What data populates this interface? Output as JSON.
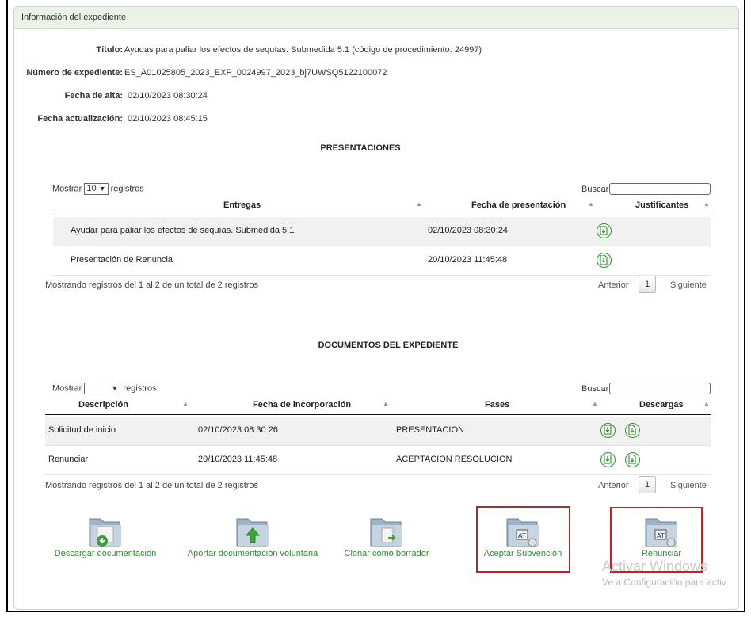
{
  "panel": {
    "title": "Información del expediente"
  },
  "info": {
    "titulo_label": "Título:",
    "titulo_value": "Ayudas para paliar los efectos de sequías. Submedida 5.1 (código de procedimiento: 24997)",
    "numero_label": "Número de expediente:",
    "numero_value": "ES_A01025805_2023_EXP_0024997_2023_bj7UWSQ5122100072",
    "alta_label": "Fecha de alta:",
    "alta_value": "02/10/2023 08:30:24",
    "actualizacion_label": "Fecha actualización:",
    "actualizacion_value": "02/10/2023 08:45:15"
  },
  "presentaciones": {
    "title": "PRESENTACIONES",
    "show_prefix": "Mostrar",
    "show_value": "10",
    "show_suffix": "registros",
    "search_label": "Buscar:",
    "columns": [
      "Entregas",
      "Fecha de presentación",
      "Justificantes"
    ],
    "rows": [
      {
        "entrega": "Ayudar para paliar los efectos de sequías. Submedida 5.1",
        "fecha": "02/10/2023 08:30:24"
      },
      {
        "entrega": "Presentación de Renuncia",
        "fecha": "20/10/2023 11:45:48"
      }
    ],
    "info": "Mostrando registros del 1 al 2 de un total de 2 registros",
    "prev": "Anterior",
    "page": "1",
    "next": "Siguiente"
  },
  "documentos": {
    "title": "DOCUMENTOS DEL EXPEDIENTE",
    "show_prefix": "Mostrar",
    "show_value": "",
    "show_suffix": "registros",
    "search_label": "Buscar:",
    "columns": [
      "Descripción",
      "Fecha de incorporación",
      "Fases",
      "Descargas"
    ],
    "rows": [
      {
        "descripcion": "Solicitud de inicio",
        "fecha": "02/10/2023 08:30:26",
        "fase": "PRESENTACION"
      },
      {
        "descripcion": "Renunciar",
        "fecha": "20/10/2023 11:45:48",
        "fase": "ACEPTACION RESOLUCION"
      }
    ],
    "info": "Mostrando registros del 1 al 2 de un total de 2 registros",
    "prev": "Anterior",
    "page": "1",
    "next": "Siguiente"
  },
  "actions": [
    {
      "label": "Descargar documentación",
      "icon": "folder-download-icon"
    },
    {
      "label": "Aportar documentación voluntaria",
      "icon": "folder-upload-icon"
    },
    {
      "label": "Clonar como borrador",
      "icon": "folder-clone-icon"
    },
    {
      "label": "Aceptar Subvención",
      "icon": "folder-settings-icon"
    },
    {
      "label": "Renunciar",
      "icon": "folder-settings-icon"
    }
  ],
  "watermark": {
    "line1": "Activar Windows",
    "line2": "Ve a Configuración para activ"
  },
  "colors": {
    "header_bg": "#eaf3e5",
    "link_green": "#2f8a2f",
    "highlight_red": "#d01c1c",
    "sort_icon": "#8a8fd8"
  }
}
